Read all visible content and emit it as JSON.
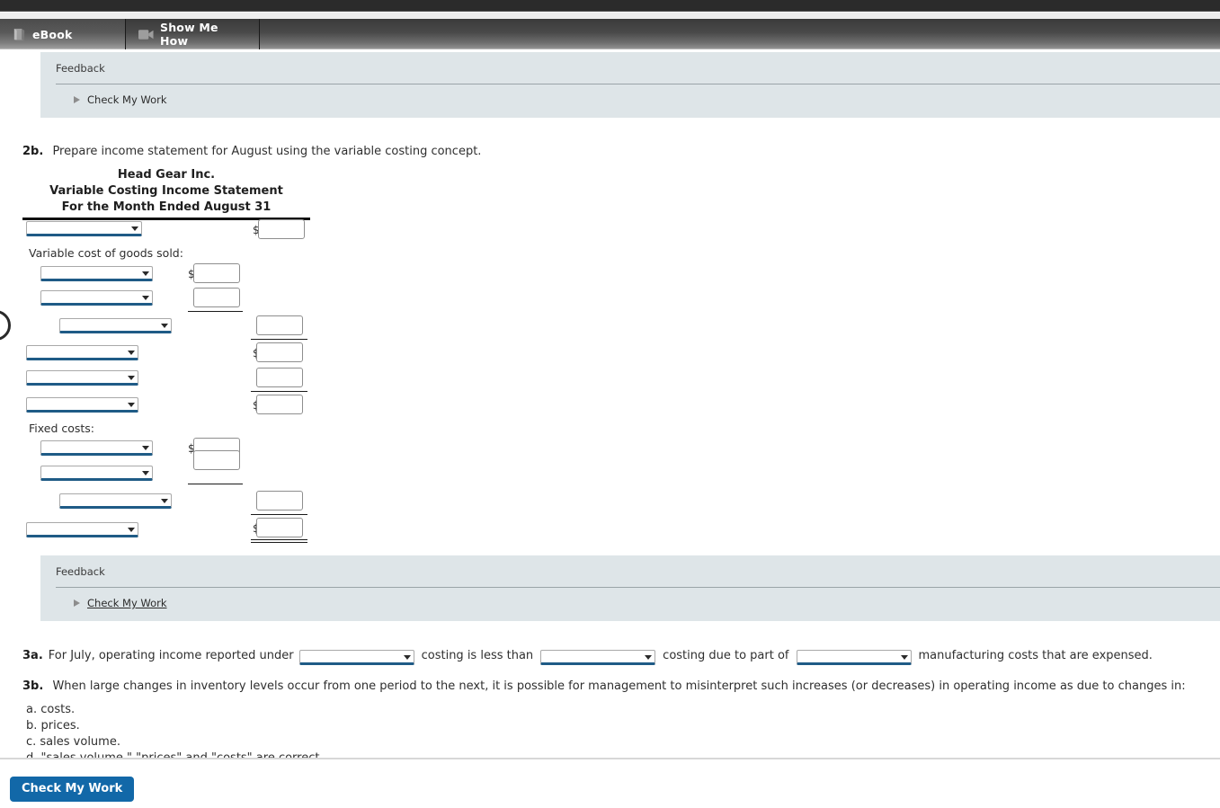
{
  "tabs": [
    {
      "label": "eBook",
      "icon": "book-icon",
      "active": true
    },
    {
      "label": "Show Me How",
      "icon": "video-camera-icon",
      "active": false
    }
  ],
  "feedback_top": {
    "title": "Feedback",
    "check_my_work": "Check My Work"
  },
  "feedback_bottom": {
    "title": "Feedback",
    "check_my_work": "Check My Work"
  },
  "question_2b": {
    "number": "2b.",
    "text": "Prepare income statement for August using the variable costing concept."
  },
  "statement": {
    "company": "Head Gear Inc.",
    "title": "Variable Costing Income Statement",
    "period": "For the Month Ended August 31",
    "section_labels": {
      "variable_cogs": "Variable cost of goods sold:",
      "fixed_costs": "Fixed costs:"
    },
    "currency_symbol": "$",
    "rows": [
      {
        "name": "sales-line",
        "select_value": "",
        "amount": ""
      },
      {
        "name": "vcogs-line-1",
        "select_value": "",
        "amount": ""
      },
      {
        "name": "vcogs-line-2",
        "select_value": "",
        "amount": ""
      },
      {
        "name": "vcogs-total-line",
        "select_value": "",
        "amount": ""
      },
      {
        "name": "manufacturing-margin",
        "select_value": "",
        "amount": ""
      },
      {
        "name": "variable-selling-line",
        "select_value": "",
        "amount": ""
      },
      {
        "name": "contribution-margin",
        "select_value": "",
        "amount": ""
      },
      {
        "name": "fixed-line-1",
        "select_value": "",
        "amount": ""
      },
      {
        "name": "fixed-line-2",
        "select_value": "",
        "amount": ""
      },
      {
        "name": "fixed-total-line",
        "select_value": "",
        "amount": ""
      },
      {
        "name": "operating-income",
        "select_value": "",
        "amount": ""
      }
    ]
  },
  "question_3a": {
    "number": "3a.",
    "lead": "For July, operating income reported under",
    "mid": "costing is less than",
    "tail": "costing due to part of",
    "end": "manufacturing costs that are expensed.",
    "select_1": "",
    "select_2": "",
    "select_3": ""
  },
  "question_3b": {
    "number": "3b.",
    "text": "When large changes in inventory levels occur from one period to the next, it is possible for management to misinterpret such increases (or decreases) in operating income as due to changes in:",
    "options": [
      "a. costs.",
      "b. prices.",
      "c. sales volume.",
      "d. \"sales volume,\" \"prices\" and \"costs\" are correct."
    ]
  },
  "footer": {
    "check_my_work_button": "Check My Work"
  },
  "colors": {
    "accent_blue": "#1268a8",
    "select_underline": "#1f5b86",
    "feedback_panel": "#dee5e8",
    "tabbar_dark": "#3a3a3a"
  }
}
